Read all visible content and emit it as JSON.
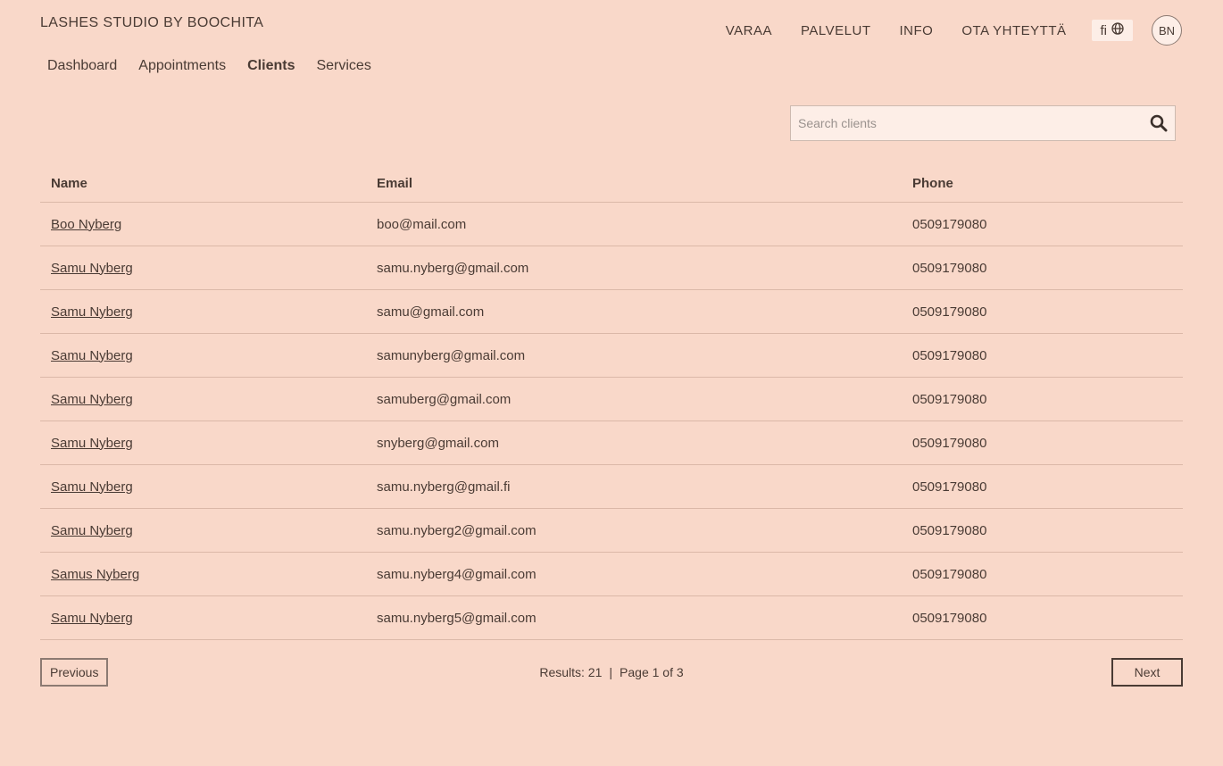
{
  "header": {
    "brand": "LASHES STUDIO BY BOOCHITA",
    "nav": [
      "VARAA",
      "PALVELUT",
      "INFO",
      "OTA YHTEYTTÄ"
    ],
    "lang": "fi",
    "avatar": "BN"
  },
  "subnav": {
    "tabs": [
      "Dashboard",
      "Appointments",
      "Clients",
      "Services"
    ],
    "active": "Clients"
  },
  "search": {
    "placeholder": "Search clients",
    "value": ""
  },
  "table": {
    "headers": {
      "name": "Name",
      "email": "Email",
      "phone": "Phone"
    },
    "rows": [
      {
        "name": "Boo Nyberg",
        "email": "boo@mail.com",
        "phone": "0509179080"
      },
      {
        "name": "Samu Nyberg",
        "email": "samu.nyberg@gmail.com",
        "phone": "0509179080"
      },
      {
        "name": "Samu Nyberg",
        "email": "samu@gmail.com",
        "phone": "0509179080"
      },
      {
        "name": "Samu Nyberg",
        "email": "samunyberg@gmail.com",
        "phone": "0509179080"
      },
      {
        "name": "Samu Nyberg",
        "email": "samuberg@gmail.com",
        "phone": "0509179080"
      },
      {
        "name": "Samu Nyberg",
        "email": "snyberg@gmail.com",
        "phone": "0509179080"
      },
      {
        "name": "Samu Nyberg",
        "email": "samu.nyberg@gmail.fi",
        "phone": "0509179080"
      },
      {
        "name": "Samu Nyberg",
        "email": "samu.nyberg2@gmail.com",
        "phone": "0509179080"
      },
      {
        "name": "Samus Nyberg",
        "email": "samu.nyberg4@gmail.com",
        "phone": "0509179080"
      },
      {
        "name": "Samu Nyberg",
        "email": "samu.nyberg5@gmail.com",
        "phone": "0509179080"
      }
    ]
  },
  "pagination": {
    "previous": "Previous",
    "next": "Next",
    "results": "Results: 21",
    "page": "Page 1 of 3"
  }
}
